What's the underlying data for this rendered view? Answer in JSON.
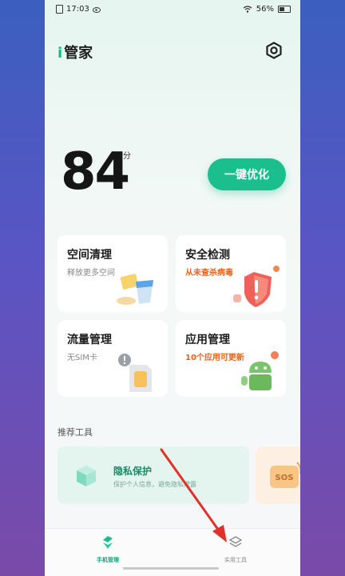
{
  "status_bar": {
    "time": "17:03",
    "battery": "56%"
  },
  "header": {
    "app_title_prefix": "i",
    "app_title": "管家"
  },
  "score": {
    "value": "84",
    "unit": "分"
  },
  "optimize_button": {
    "label": "一键优化"
  },
  "cards": [
    {
      "title": "空间清理",
      "subtitle": "释放更多空间"
    },
    {
      "title": "安全检测",
      "subtitle": "从未查杀病毒"
    },
    {
      "title": "流量管理",
      "subtitle": "无SIM卡"
    },
    {
      "title": "应用管理",
      "subtitle": "10个应用可更新"
    }
  ],
  "tools_section": {
    "title": "推荐工具",
    "items": [
      {
        "title": "隐私保护",
        "subtitle": "保护个人信息，避免隐私泄露"
      },
      {
        "badge": "SOS"
      }
    ]
  },
  "bottom_nav": [
    {
      "label": "手机管理",
      "active": true
    },
    {
      "label": "实用工具",
      "active": false
    }
  ],
  "colors": {
    "accent": "#1bbf8e",
    "warning": "#e8631c",
    "arrow": "#e0322a"
  }
}
